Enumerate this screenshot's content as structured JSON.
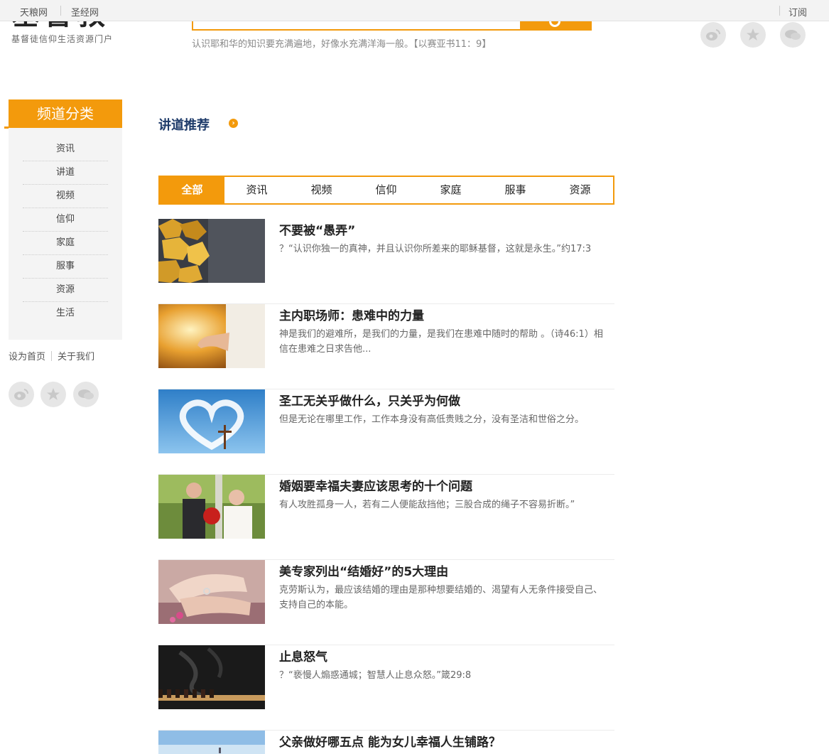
{
  "topbar": {
    "links": [
      "天粮网",
      "圣经网"
    ],
    "subscribe": "订阅"
  },
  "header": {
    "logo_mark": "基督教",
    "logo_sub": "基督徒信仰生活资源门户",
    "verse": "认识耶和华的知识要充满遍地，好像水充满洋海一般。【以赛亚书11：9】",
    "social_icons": [
      "weibo-icon",
      "qzone-icon",
      "chat-icon"
    ]
  },
  "sidebar": {
    "heading": "频道分类",
    "items": [
      "资讯",
      "讲道",
      "视频",
      "信仰",
      "家庭",
      "服事",
      "资源",
      "生活"
    ],
    "links": [
      "设为首页",
      "关于我们"
    ]
  },
  "main": {
    "section_title": "讲道推荐",
    "tabs": [
      "全部",
      "资讯",
      "视频",
      "信仰",
      "家庭",
      "服事",
      "资源"
    ],
    "active_tab": "全部",
    "articles": [
      {
        "title": "不要被“愚弄”",
        "summary": "？“认识你独一的真神，并且认识你所差来的耶稣基督，这就是永生。”约17:3"
      },
      {
        "title": "主内职场师：患难中的力量",
        "summary": "神是我们的避难所，是我们的力量，是我们在患难中随时的帮助 。（诗46:1）相信在患难之日求告他..."
      },
      {
        "title": "圣工无关乎做什么，只关乎为何做",
        "summary": "但是无论在哪里工作，工作本身没有高低贵贱之分，没有圣洁和世俗之分。"
      },
      {
        "title": "婚姻要幸福夫妻应该思考的十个问题",
        "summary": "有人攻胜孤身一人，若有二人便能敌挡他；三股合成的绳子不容易折断。”"
      },
      {
        "title": "美专家列出“结婚好”的5大理由",
        "summary": "克劳斯认为，最应该结婚的理由是那种想要结婚的、渴望有人无条件接受自己、支持自己的本能。"
      },
      {
        "title": "止息怒气",
        "summary": "？“亵慢人煽惑通城；智慧人止息众怒。”箴29:8"
      },
      {
        "title": "父亲做好哪五点 能为女儿幸福人生铺路？",
        "summary": ""
      }
    ]
  },
  "colors": {
    "accent": "#f39a0c",
    "title_blue": "#1e3b6a"
  }
}
